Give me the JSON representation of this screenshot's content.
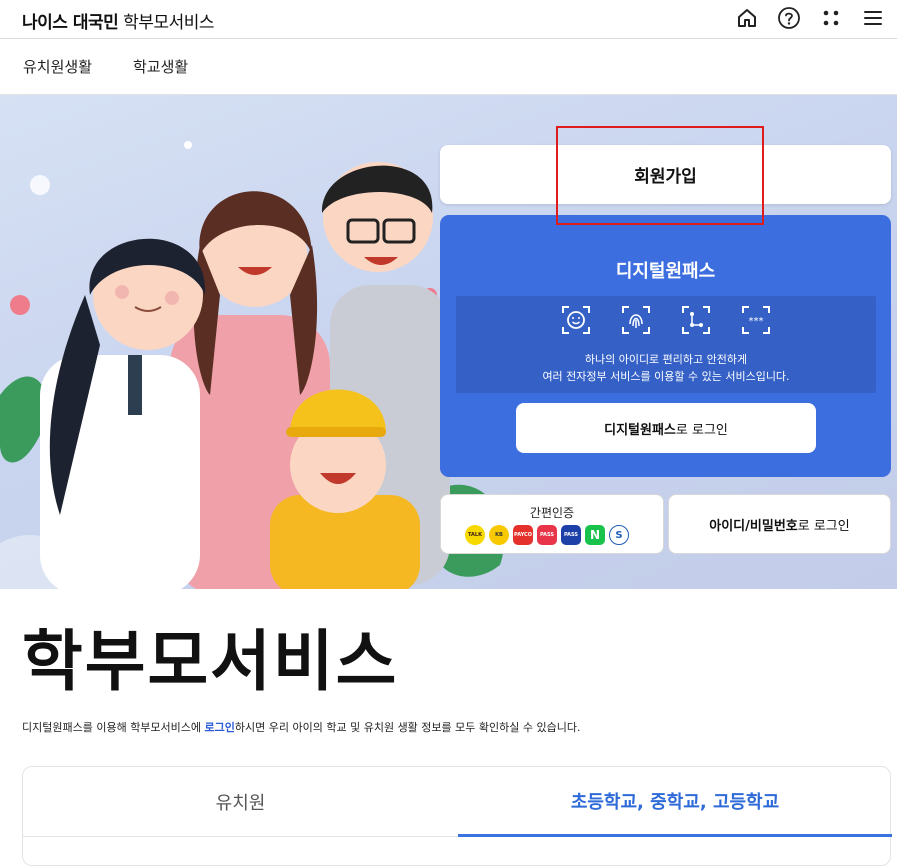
{
  "header": {
    "brand_strong": "나이스 대국민",
    "brand_sub": "학부모서비스",
    "icons": [
      "home-icon",
      "help-icon",
      "apps-icon",
      "menu-icon"
    ]
  },
  "nav": {
    "items": [
      {
        "label": "유치원생활"
      },
      {
        "label": "학교생활"
      }
    ]
  },
  "hero": {
    "signup_label": "회원가입",
    "digital": {
      "title": "디지털원패스",
      "icons": [
        "face-scan-icon",
        "fingerprint-icon",
        "pattern-icon",
        "pin-icon"
      ],
      "desc_line1": "하나의 아이디로 편리하고 안전하게",
      "desc_line2": "여러 전자정부 서비스를 이용할 수 있는 서비스입니다.",
      "login_strong": "디지털원패스",
      "login_rest": "로 로그인"
    },
    "easy_auth": {
      "label": "간편인증",
      "logos": [
        {
          "name": "kakao-logo",
          "text": "TALK",
          "color": "#f7d900",
          "text_color": "#3a1d1d"
        },
        {
          "name": "kb-logo",
          "text": "KB",
          "color": "#f8c800",
          "text_color": "#333333"
        },
        {
          "name": "payco-logo",
          "text": "PAYCO",
          "color": "#e4312b",
          "text_color": "#ffffff"
        },
        {
          "name": "pass-logo",
          "text": "PASS",
          "color": "#e8354a",
          "text_color": "#ffffff"
        },
        {
          "name": "samsung-pass-logo",
          "text": "PASS",
          "color": "#1d3fa8",
          "text_color": "#ffffff"
        },
        {
          "name": "naver-logo",
          "text": "N",
          "color": "#19c24b",
          "text_color": "#ffffff"
        },
        {
          "name": "shinhan-logo",
          "text": "S",
          "color": "#ffffff",
          "text_color": "#1f5db8"
        }
      ]
    },
    "id_login_strong": "아이디/비밀번호",
    "id_login_rest": "로 로그인"
  },
  "main": {
    "title": "학부모서비스",
    "desc_before": "디지털원패스를 이용해 학부모서비스에 ",
    "desc_link": "로그인",
    "desc_after": "하시면 우리 아이의 학교 및 유치원 생활 정보를 모두 확인하실 수 있습니다.",
    "tabs": [
      {
        "label": "유치원",
        "active": false
      },
      {
        "label": "초등학교, 중학교, 고등학교",
        "active": true
      }
    ]
  },
  "colors": {
    "accent": "#3d6ee0",
    "highlight": "#e01b1b",
    "active_tab": "#2f6bd8"
  }
}
